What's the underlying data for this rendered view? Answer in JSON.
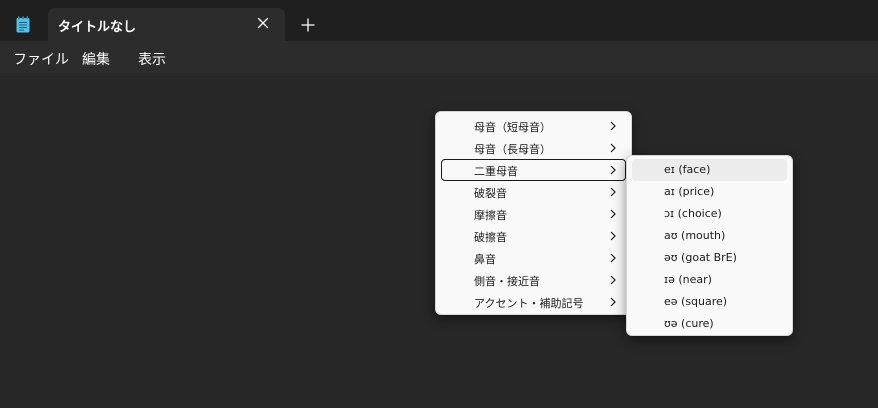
{
  "tab": {
    "title": "タイトルなし"
  },
  "menubar": {
    "items": [
      "ファイル",
      "編集",
      "表示"
    ]
  },
  "context_menu": {
    "items": [
      {
        "label": "母音（短母音）",
        "has_submenu": true
      },
      {
        "label": "母音（長母音）",
        "has_submenu": true
      },
      {
        "label": "二重母音",
        "has_submenu": true,
        "state": "focused"
      },
      {
        "label": "破裂音",
        "has_submenu": true
      },
      {
        "label": "摩擦音",
        "has_submenu": true
      },
      {
        "label": "破擦音",
        "has_submenu": true
      },
      {
        "label": "鼻音",
        "has_submenu": true
      },
      {
        "label": "側音・接近音",
        "has_submenu": true
      },
      {
        "label": "アクセント・補助記号",
        "has_submenu": true
      }
    ]
  },
  "submenu": {
    "items": [
      {
        "label": "eɪ (face)",
        "state": "hover"
      },
      {
        "label": "aɪ (price)"
      },
      {
        "label": "ɔɪ (choice)"
      },
      {
        "label": "aʊ (mouth)"
      },
      {
        "label": "əʊ (goat BrE)"
      },
      {
        "label": "ɪə (near)"
      },
      {
        "label": "eə (square)"
      },
      {
        "label": "ʊə (cure)"
      }
    ]
  },
  "icons": {
    "app": "notepad-icon",
    "close": "close-icon",
    "new_tab": "plus-icon",
    "submenu": "chevron-right-icon"
  },
  "colors": {
    "titlebar": "#1f1f1f",
    "menubar": "#2c2c2c",
    "editor": "#272727",
    "menu_bg": "#f9f9f9",
    "app_icon": "#4cc2e8"
  }
}
